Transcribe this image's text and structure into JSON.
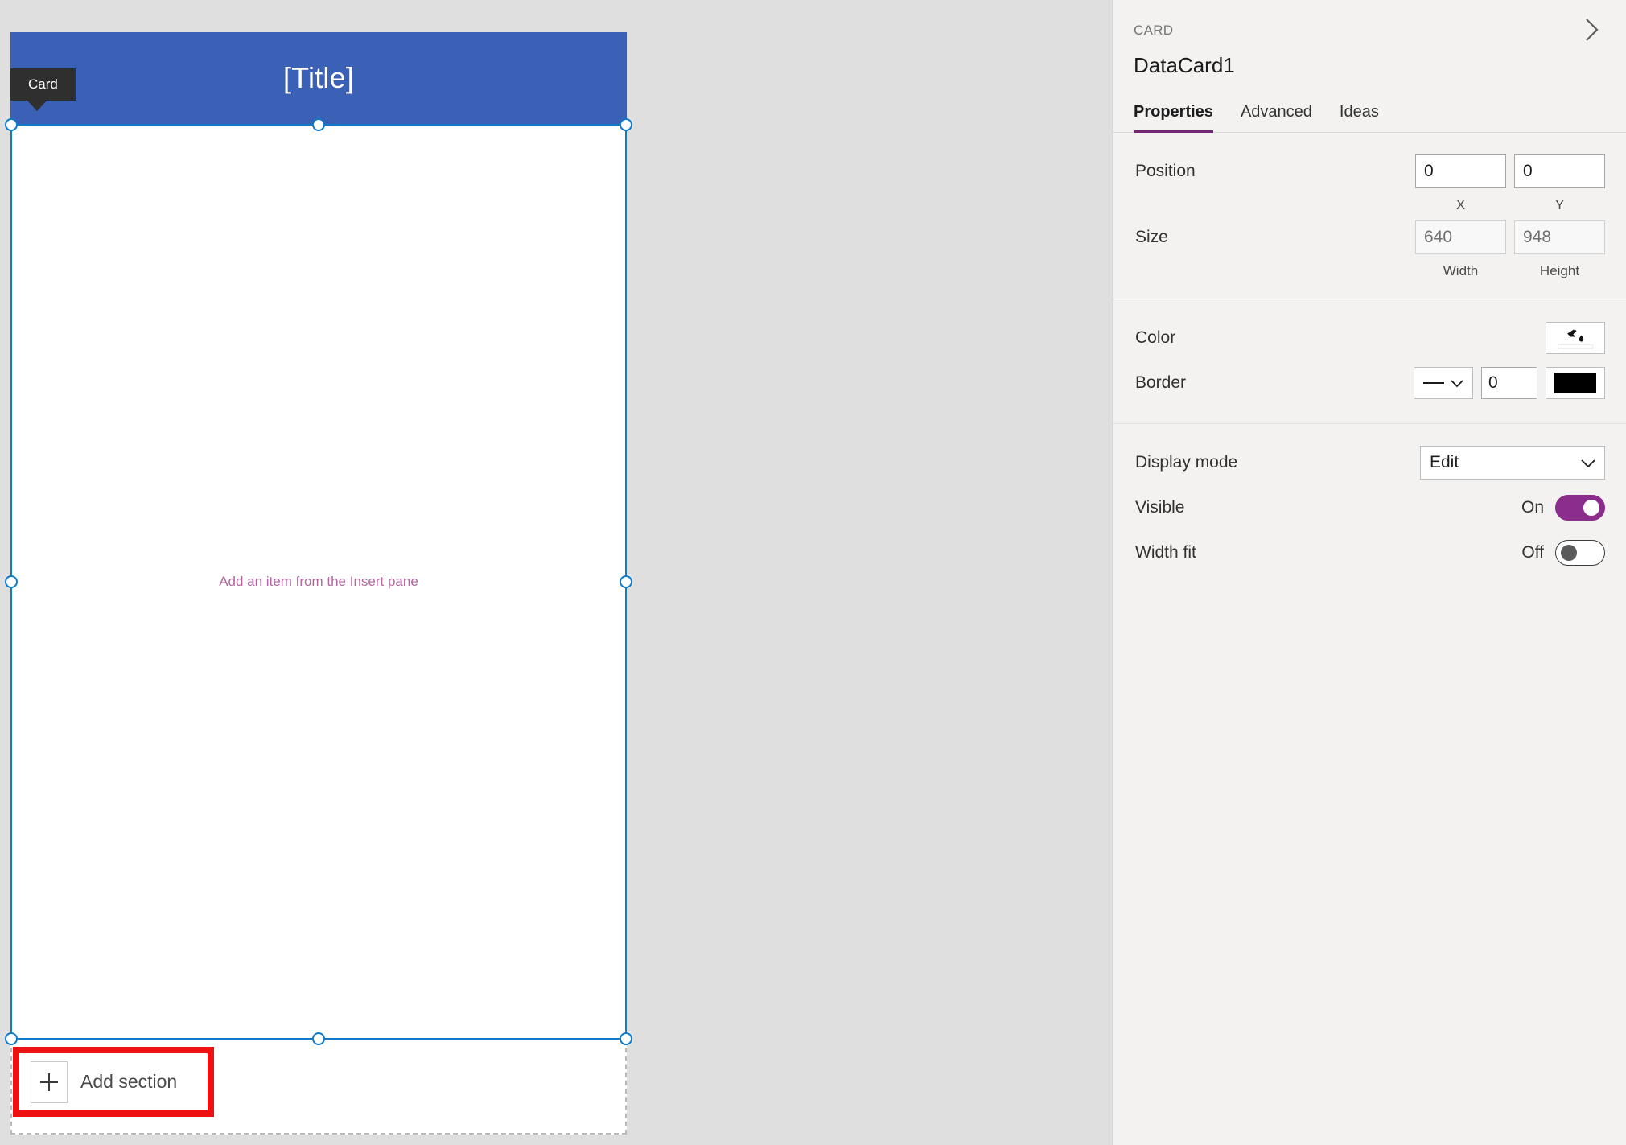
{
  "canvas": {
    "card_badge_label": "Card",
    "title_text": "[Title]",
    "placeholder_text": "Add an item from the Insert pane",
    "add_section_label": "Add section",
    "plus_icon": "plus-icon",
    "highlight_color": "#ee1111",
    "title_bar_color": "#3a61b5",
    "selection_color": "#0f7ac7",
    "placeholder_color": "#b2669f"
  },
  "panel": {
    "kicker": "CARD",
    "title": "DataCard1",
    "collapse_icon": "chevron-right-icon",
    "tabs": [
      {
        "label": "Properties",
        "active": true
      },
      {
        "label": "Advanced",
        "active": false
      },
      {
        "label": "Ideas",
        "active": false
      }
    ],
    "accent_color": "#742774",
    "groups": {
      "layout": {
        "position": {
          "label": "Position",
          "x_value": "0",
          "y_value": "0",
          "x_sub": "X",
          "y_sub": "Y"
        },
        "size": {
          "label": "Size",
          "width_value": "640",
          "height_value": "948",
          "width_sub": "Width",
          "height_sub": "Height"
        }
      },
      "appearance": {
        "color": {
          "label": "Color",
          "icon": "paint-bucket-icon",
          "swatch_value": "#ffffff"
        },
        "border": {
          "label": "Border",
          "style_icon": "solid-line-icon",
          "style_chevron": "chevron-down-icon",
          "width_value": "0",
          "color_value": "#000000"
        }
      },
      "behavior": {
        "display_mode": {
          "label": "Display mode",
          "value": "Edit",
          "chevron": "chevron-down-icon"
        },
        "visible": {
          "label": "Visible",
          "state": "On",
          "on": true
        },
        "width_fit": {
          "label": "Width fit",
          "state": "Off",
          "on": false
        }
      }
    }
  }
}
